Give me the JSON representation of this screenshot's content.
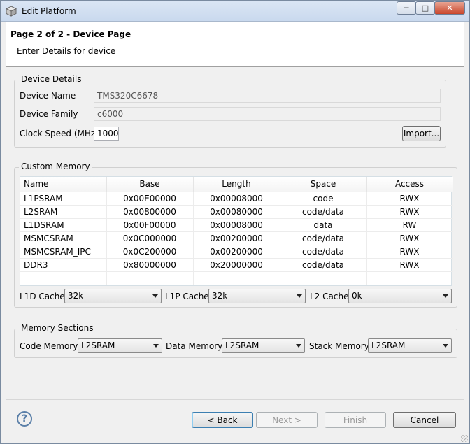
{
  "window": {
    "title": "Edit Platform",
    "minimize_glyph": "─",
    "maximize_glyph": "□",
    "close_glyph": "✕"
  },
  "header": {
    "title": "Page 2 of 2 - Device Page",
    "subtitle": "Enter Details for device"
  },
  "device_details": {
    "group_label": "Device Details",
    "name_label": "Device Name",
    "name_value": "TMS320C6678",
    "family_label": "Device Family",
    "family_value": "c6000",
    "clock_label": "Clock Speed (MHz)",
    "clock_value": "1000",
    "import_label": "Import..."
  },
  "custom_memory": {
    "group_label": "Custom Memory",
    "columns": [
      "Name",
      "Base",
      "Length",
      "Space",
      "Access"
    ],
    "rows": [
      [
        "L1PSRAM",
        "0x00E00000",
        "0x00008000",
        "code",
        "RWX"
      ],
      [
        "L2SRAM",
        "0x00800000",
        "0x00080000",
        "code/data",
        "RWX"
      ],
      [
        "L1DSRAM",
        "0x00F00000",
        "0x00008000",
        "data",
        "RW"
      ],
      [
        "MSMCSRAM",
        "0x0C000000",
        "0x00200000",
        "code/data",
        "RWX"
      ],
      [
        "MSMCSRAM_IPC",
        "0x0C200000",
        "0x00200000",
        "code/data",
        "RWX"
      ],
      [
        "DDR3",
        "0x80000000",
        "0x20000000",
        "code/data",
        "RWX"
      ]
    ],
    "l1d_label": "L1D Cache:",
    "l1d_value": "32k",
    "l1p_label": "L1P Cache:",
    "l1p_value": "32k",
    "l2_label": "L2 Cache:",
    "l2_value": "0k"
  },
  "memory_sections": {
    "group_label": "Memory Sections",
    "code_label": "Code Memory:",
    "code_value": "L2SRAM",
    "data_label": "Data Memory:",
    "data_value": "L2SRAM",
    "stack_label": "Stack Memory:",
    "stack_value": "L2SRAM"
  },
  "footer": {
    "help_glyph": "?",
    "back_label": "< Back",
    "next_label": "Next >",
    "finish_label": "Finish",
    "cancel_label": "Cancel"
  }
}
